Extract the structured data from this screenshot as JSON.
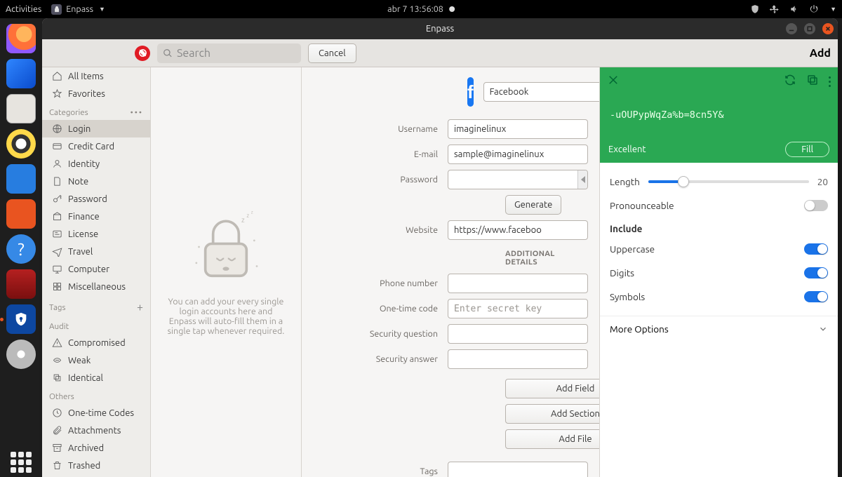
{
  "topbar": {
    "activities": "Activities",
    "app_name": "Enpass",
    "clock": "abr 7  13:56:08"
  },
  "dock": {
    "items": [
      "firefox",
      "thunderbird",
      "files",
      "rhythmbox",
      "libreoffice",
      "software",
      "help",
      "screenshot",
      "enpass",
      "disk"
    ]
  },
  "window": {
    "title": "Enpass",
    "search_placeholder": "Search",
    "cancel": "Cancel",
    "add": "Add"
  },
  "sidebar": {
    "top": [
      {
        "icon": "home",
        "label": "All Items"
      },
      {
        "icon": "star",
        "label": "Favorites"
      }
    ],
    "categories_label": "Categories",
    "categories": [
      {
        "icon": "globe",
        "label": "Login",
        "selected": true
      },
      {
        "icon": "card",
        "label": "Credit Card"
      },
      {
        "icon": "id",
        "label": "Identity"
      },
      {
        "icon": "note",
        "label": "Note"
      },
      {
        "icon": "key",
        "label": "Password"
      },
      {
        "icon": "finance",
        "label": "Finance"
      },
      {
        "icon": "license",
        "label": "License"
      },
      {
        "icon": "plane",
        "label": "Travel"
      },
      {
        "icon": "computer",
        "label": "Computer"
      },
      {
        "icon": "misc",
        "label": "Miscellaneous"
      }
    ],
    "tags_label": "Tags",
    "audit_label": "Audit",
    "audit": [
      {
        "icon": "warn",
        "label": "Compromised"
      },
      {
        "icon": "weak",
        "label": "Weak"
      },
      {
        "icon": "dup",
        "label": "Identical"
      }
    ],
    "others_label": "Others",
    "others": [
      {
        "icon": "clock",
        "label": "One-time Codes"
      },
      {
        "icon": "attach",
        "label": "Attachments"
      },
      {
        "icon": "archive",
        "label": "Archived"
      },
      {
        "icon": "trash",
        "label": "Trashed"
      }
    ]
  },
  "empty": {
    "text": "You can add your every single login accounts here and Enpass will auto-fill them in a single tap whenever required."
  },
  "form": {
    "title_value": "Facebook",
    "fields": {
      "username_label": "Username",
      "username_value": "imaginelinux",
      "email_label": "E-mail",
      "email_value": "sample@imaginelinux",
      "password_label": "Password",
      "generate": "Generate",
      "website_label": "Website",
      "website_value": "https://www.faceboo",
      "additional": "ADDITIONAL DETAILS",
      "phone_label": "Phone number",
      "otp_label": "One-time code",
      "otp_placeholder": "Enter secret key",
      "secq_label": "Security question",
      "seca_label": "Security answer",
      "add_field": "Add Field",
      "add_section": "Add Section",
      "add_file": "Add File",
      "tags_label": "Tags"
    }
  },
  "pgen": {
    "password": "-uOUPypWqZa%b=8cn5Y&",
    "strength": "Excellent",
    "fill": "Fill",
    "length_label": "Length",
    "length_value": "20",
    "pronounceable": "Pronounceable",
    "include": "Include",
    "uppercase": "Uppercase",
    "digits": "Digits",
    "symbols": "Symbols",
    "more": "More Options"
  }
}
